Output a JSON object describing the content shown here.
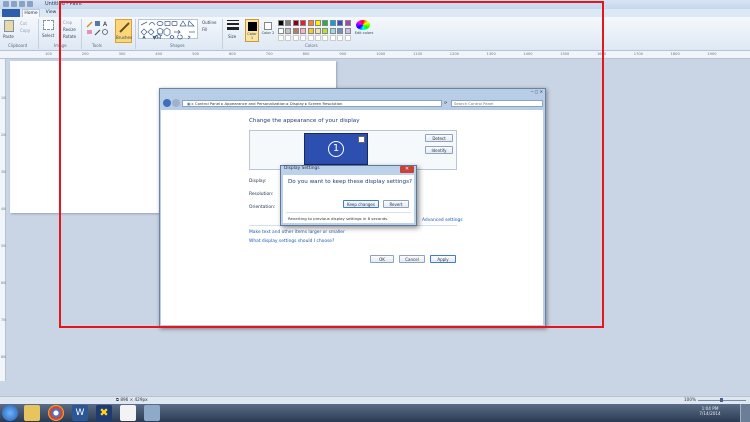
{
  "window": {
    "title": "Untitled - Paint"
  },
  "tabs": {
    "file": "",
    "home": "Home",
    "view": "View"
  },
  "ribbon": {
    "clipboard": {
      "paste": "Paste",
      "cut": "Cut",
      "copy": "Copy",
      "label": "Clipboard"
    },
    "image": {
      "select": "Select",
      "crop": "Crop",
      "resize": "Resize",
      "rotate": "Rotate",
      "label": "Image"
    },
    "tools": {
      "label": "Tools",
      "brushes": "Brushes"
    },
    "shapes": {
      "outline": "Outline",
      "fill": "Fill",
      "label": "Shapes"
    },
    "size": "Size",
    "color1": "Color 1",
    "color2": "Color 2",
    "edit_colors": "Edit colors",
    "colors_label": "Colors"
  },
  "ruler": {
    "ticks": [
      "100",
      "200",
      "300",
      "400",
      "500",
      "600",
      "700",
      "800",
      "900",
      "1000",
      "1100",
      "1200",
      "1300",
      "1400",
      "1500",
      "1600",
      "1700",
      "1800",
      "1900"
    ]
  },
  "vruler": {
    "ticks": [
      "100",
      "200",
      "300",
      "400",
      "500",
      "600",
      "700",
      "800",
      "900"
    ]
  },
  "screenshot": {
    "breadcrumb": [
      "Control Panel",
      "Appearance and Personalization",
      "Display",
      "Screen Resolution"
    ],
    "search_placeholder": "Search Control Panel",
    "heading": "Change the appearance of your display",
    "monitor_number": "1",
    "detect": "Detect",
    "identify": "Identify",
    "display_label": "Display:",
    "resolution_label": "Resolution:",
    "orientation_label": "Orientation:",
    "advanced_settings": "Advanced settings",
    "link1": "Make text and other items larger or smaller",
    "link2": "What display settings should I choose?",
    "ok": "OK",
    "cancel": "Cancel",
    "apply": "Apply"
  },
  "dialog": {
    "title": "Display Settings",
    "question": "Do you want to keep these display settings?",
    "keep": "Keep changes",
    "revert": "Revert",
    "countdown": "Reverting to previous display settings in 8 seconds."
  },
  "status": {
    "size": "896 × 429px",
    "zoom": "100%"
  },
  "taskbar": {
    "time": "1:04 PM",
    "date": "7/14/2014"
  },
  "colors": {
    "accent": "#2c5fa8",
    "selection": "#e8141c"
  }
}
